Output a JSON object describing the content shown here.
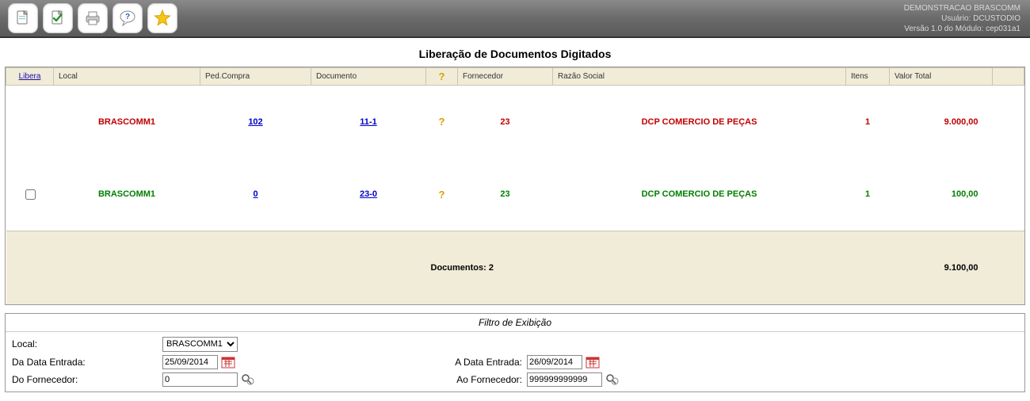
{
  "header": {
    "company": "DEMONSTRACAO BRASCOMM",
    "user_line": "Usuário: DCUSTODIO",
    "version_line": "Versão 1.0 do Módulo: cep031a1"
  },
  "page_title": "Liberação de Documentos Digitados",
  "columns": {
    "libera": "Libera",
    "local": "Local",
    "ped_compra": "Ped.Compra",
    "documento": "Documento",
    "q": "?",
    "fornecedor": "Fornecedor",
    "razao_social": "Razão Social",
    "itens": "Itens",
    "valor_total": "Valor Total"
  },
  "rows": [
    {
      "local": "BRASCOMM1",
      "ped_compra": "102",
      "documento": "11-1",
      "fornecedor": "23",
      "razao_social": "DCP COMERCIO DE PEÇAS",
      "itens": "1",
      "valor_total": "9.000,00"
    },
    {
      "local": "BRASCOMM1",
      "ped_compra": "0",
      "documento": "23-0",
      "fornecedor": "23",
      "razao_social": "DCP COMERCIO DE PEÇAS",
      "itens": "1",
      "valor_total": "100,00"
    }
  ],
  "summary": {
    "docs_label": "Documentos: 2",
    "total": "9.100,00"
  },
  "filter": {
    "title": "Filtro de Exibição",
    "local_label": "Local:",
    "local_value": "BRASCOMM1",
    "da_data_label": "Da Data Entrada:",
    "da_data_value": "25/09/2014",
    "a_data_label": "A Data Entrada:",
    "a_data_value": "26/09/2014",
    "do_forn_label": "Do Fornecedor:",
    "do_forn_value": "0",
    "ao_forn_label": "Ao Fornecedor:",
    "ao_forn_value": "999999999999"
  }
}
